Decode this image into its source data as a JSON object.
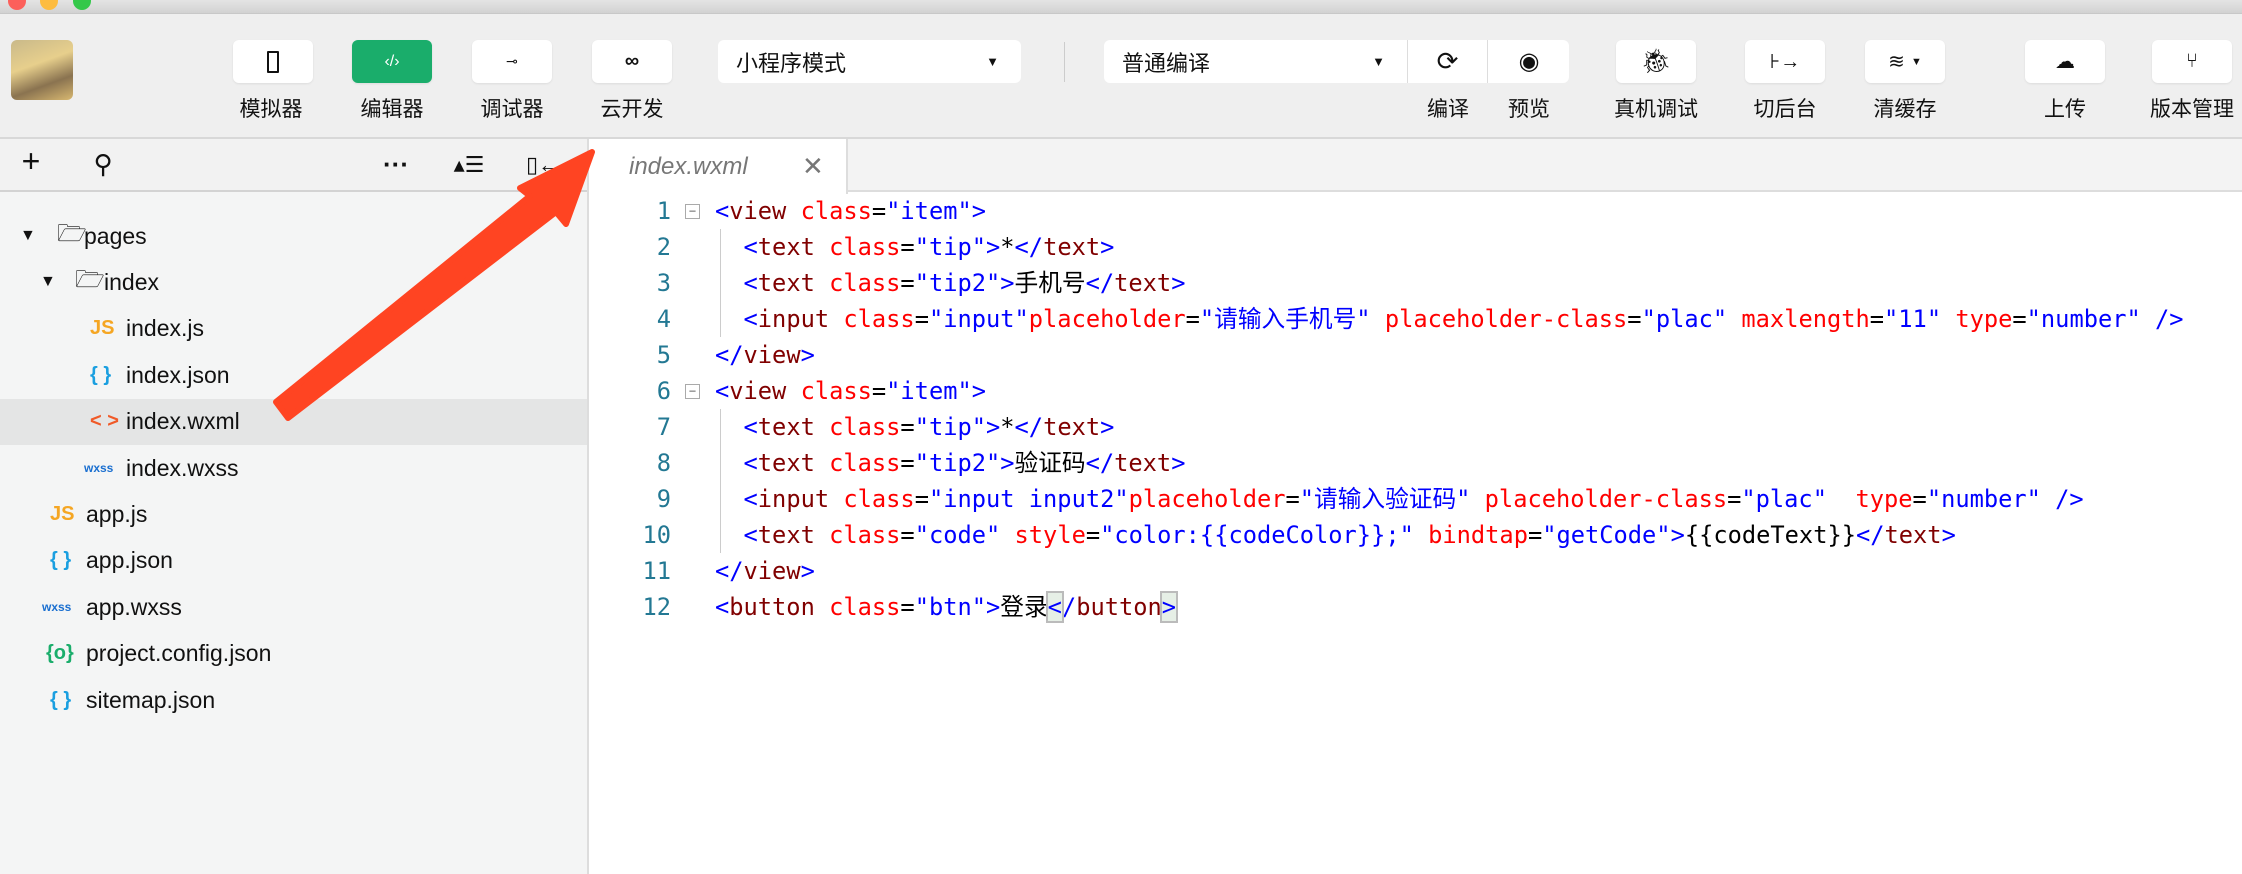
{
  "toolbar": {
    "buttons": [
      {
        "label": "模拟器",
        "icon": "phone-icon"
      },
      {
        "label": "编辑器",
        "icon": "code-icon"
      },
      {
        "label": "调试器",
        "icon": "debugger-icon"
      },
      {
        "label": "云开发",
        "icon": "cloud-dev-icon"
      }
    ],
    "mode_select": "小程序模式",
    "compile_select": "普通编译",
    "actions": [
      {
        "label": "编译",
        "icon": "refresh-icon"
      },
      {
        "label": "预览",
        "icon": "eye-icon"
      },
      {
        "label": "真机调试",
        "icon": "bug-icon"
      },
      {
        "label": "切后台",
        "icon": "switch-background-icon"
      },
      {
        "label": "清缓存",
        "icon": "layers-icon"
      },
      {
        "label": "上传",
        "icon": "cloud-upload-icon"
      },
      {
        "label": "版本管理",
        "icon": "branch-icon"
      }
    ],
    "accent": "#1aad6b"
  },
  "sidebar": {
    "tree": [
      {
        "name": "pages",
        "type": "folder"
      },
      {
        "name": "index",
        "type": "folder"
      },
      {
        "name": "index.js",
        "type": "js",
        "badge": "JS"
      },
      {
        "name": "index.json",
        "type": "json",
        "badge": "{ }"
      },
      {
        "name": "index.wxml",
        "type": "wxml",
        "badge": "< >",
        "selected": true
      },
      {
        "name": "index.wxss",
        "type": "wxss",
        "badge": "wxss"
      },
      {
        "name": "app.js",
        "type": "js",
        "badge": "JS"
      },
      {
        "name": "app.json",
        "type": "json",
        "badge": "{ }"
      },
      {
        "name": "app.wxss",
        "type": "wxss",
        "badge": "wxss"
      },
      {
        "name": "project.config.json",
        "type": "config",
        "badge": "{o}"
      },
      {
        "name": "sitemap.json",
        "type": "json",
        "badge": "{ }"
      }
    ]
  },
  "editor": {
    "tab": "index.wxml",
    "lines": [
      {
        "n": "1",
        "tokens": [
          {
            "k": "p",
            "v": "<"
          },
          {
            "k": "t",
            "v": "view"
          },
          {
            "k": "w",
            "v": " "
          },
          {
            "k": "a",
            "v": "class"
          },
          {
            "k": "e",
            "v": "="
          },
          {
            "k": "s",
            "v": "\"item\""
          },
          {
            "k": "p",
            "v": ">"
          }
        ]
      },
      {
        "n": "2",
        "tokens": [
          {
            "k": "w",
            "v": "  "
          },
          {
            "k": "p",
            "v": "<"
          },
          {
            "k": "t",
            "v": "text"
          },
          {
            "k": "w",
            "v": " "
          },
          {
            "k": "a",
            "v": "class"
          },
          {
            "k": "e",
            "v": "="
          },
          {
            "k": "s",
            "v": "\"tip\""
          },
          {
            "k": "p",
            "v": ">"
          },
          {
            "k": "x",
            "v": "*"
          },
          {
            "k": "p",
            "v": "</"
          },
          {
            "k": "t",
            "v": "text"
          },
          {
            "k": "p",
            "v": ">"
          }
        ]
      },
      {
        "n": "3",
        "tokens": [
          {
            "k": "w",
            "v": "  "
          },
          {
            "k": "p",
            "v": "<"
          },
          {
            "k": "t",
            "v": "text"
          },
          {
            "k": "w",
            "v": " "
          },
          {
            "k": "a",
            "v": "class"
          },
          {
            "k": "e",
            "v": "="
          },
          {
            "k": "s",
            "v": "\"tip2\""
          },
          {
            "k": "p",
            "v": ">"
          },
          {
            "k": "x",
            "v": "手机号"
          },
          {
            "k": "p",
            "v": "</"
          },
          {
            "k": "t",
            "v": "text"
          },
          {
            "k": "p",
            "v": ">"
          }
        ]
      },
      {
        "n": "4",
        "tokens": [
          {
            "k": "w",
            "v": "  "
          },
          {
            "k": "p",
            "v": "<"
          },
          {
            "k": "t",
            "v": "input"
          },
          {
            "k": "w",
            "v": " "
          },
          {
            "k": "a",
            "v": "class"
          },
          {
            "k": "e",
            "v": "="
          },
          {
            "k": "s",
            "v": "\"input\""
          },
          {
            "k": "a",
            "v": "placeholder"
          },
          {
            "k": "e",
            "v": "="
          },
          {
            "k": "s",
            "v": "\"请输入手机号\""
          },
          {
            "k": "w",
            "v": " "
          },
          {
            "k": "a",
            "v": "placeholder-class"
          },
          {
            "k": "e",
            "v": "="
          },
          {
            "k": "s",
            "v": "\"plac\""
          },
          {
            "k": "w",
            "v": " "
          },
          {
            "k": "a",
            "v": "maxlength"
          },
          {
            "k": "e",
            "v": "="
          },
          {
            "k": "s",
            "v": "\"11\""
          },
          {
            "k": "w",
            "v": " "
          },
          {
            "k": "a",
            "v": "type"
          },
          {
            "k": "e",
            "v": "="
          },
          {
            "k": "s",
            "v": "\"number\""
          },
          {
            "k": "w",
            "v": " "
          },
          {
            "k": "p",
            "v": "/>"
          }
        ]
      },
      {
        "n": "5",
        "tokens": [
          {
            "k": "p",
            "v": "</"
          },
          {
            "k": "t",
            "v": "view"
          },
          {
            "k": "p",
            "v": ">"
          }
        ]
      },
      {
        "n": "6",
        "tokens": [
          {
            "k": "p",
            "v": "<"
          },
          {
            "k": "t",
            "v": "view"
          },
          {
            "k": "w",
            "v": " "
          },
          {
            "k": "a",
            "v": "class"
          },
          {
            "k": "e",
            "v": "="
          },
          {
            "k": "s",
            "v": "\"item\""
          },
          {
            "k": "p",
            "v": ">"
          }
        ]
      },
      {
        "n": "7",
        "tokens": [
          {
            "k": "w",
            "v": "  "
          },
          {
            "k": "p",
            "v": "<"
          },
          {
            "k": "t",
            "v": "text"
          },
          {
            "k": "w",
            "v": " "
          },
          {
            "k": "a",
            "v": "class"
          },
          {
            "k": "e",
            "v": "="
          },
          {
            "k": "s",
            "v": "\"tip\""
          },
          {
            "k": "p",
            "v": ">"
          },
          {
            "k": "x",
            "v": "*"
          },
          {
            "k": "p",
            "v": "</"
          },
          {
            "k": "t",
            "v": "text"
          },
          {
            "k": "p",
            "v": ">"
          }
        ]
      },
      {
        "n": "8",
        "tokens": [
          {
            "k": "w",
            "v": "  "
          },
          {
            "k": "p",
            "v": "<"
          },
          {
            "k": "t",
            "v": "text"
          },
          {
            "k": "w",
            "v": " "
          },
          {
            "k": "a",
            "v": "class"
          },
          {
            "k": "e",
            "v": "="
          },
          {
            "k": "s",
            "v": "\"tip2\""
          },
          {
            "k": "p",
            "v": ">"
          },
          {
            "k": "x",
            "v": "验证码"
          },
          {
            "k": "p",
            "v": "</"
          },
          {
            "k": "t",
            "v": "text"
          },
          {
            "k": "p",
            "v": ">"
          }
        ]
      },
      {
        "n": "9",
        "tokens": [
          {
            "k": "w",
            "v": "  "
          },
          {
            "k": "p",
            "v": "<"
          },
          {
            "k": "t",
            "v": "input"
          },
          {
            "k": "w",
            "v": " "
          },
          {
            "k": "a",
            "v": "class"
          },
          {
            "k": "e",
            "v": "="
          },
          {
            "k": "s",
            "v": "\"input input2\""
          },
          {
            "k": "a",
            "v": "placeholder"
          },
          {
            "k": "e",
            "v": "="
          },
          {
            "k": "s",
            "v": "\"请输入验证码\""
          },
          {
            "k": "w",
            "v": " "
          },
          {
            "k": "a",
            "v": "placeholder-class"
          },
          {
            "k": "e",
            "v": "="
          },
          {
            "k": "s",
            "v": "\"plac\""
          },
          {
            "k": "w",
            "v": "  "
          },
          {
            "k": "a",
            "v": "type"
          },
          {
            "k": "e",
            "v": "="
          },
          {
            "k": "s",
            "v": "\"number\""
          },
          {
            "k": "w",
            "v": " "
          },
          {
            "k": "p",
            "v": "/>"
          }
        ]
      },
      {
        "n": "10",
        "tokens": [
          {
            "k": "w",
            "v": "  "
          },
          {
            "k": "p",
            "v": "<"
          },
          {
            "k": "t",
            "v": "text"
          },
          {
            "k": "w",
            "v": " "
          },
          {
            "k": "a",
            "v": "class"
          },
          {
            "k": "e",
            "v": "="
          },
          {
            "k": "s",
            "v": "\"code\""
          },
          {
            "k": "w",
            "v": " "
          },
          {
            "k": "a",
            "v": "style"
          },
          {
            "k": "e",
            "v": "="
          },
          {
            "k": "s",
            "v": "\"color:{{codeColor}};\""
          },
          {
            "k": "w",
            "v": " "
          },
          {
            "k": "a",
            "v": "bindtap"
          },
          {
            "k": "e",
            "v": "="
          },
          {
            "k": "s",
            "v": "\"getCode\""
          },
          {
            "k": "p",
            "v": ">"
          },
          {
            "k": "x",
            "v": "{{codeText}}"
          },
          {
            "k": "p",
            "v": "</"
          },
          {
            "k": "t",
            "v": "text"
          },
          {
            "k": "p",
            "v": ">"
          }
        ]
      },
      {
        "n": "11",
        "tokens": [
          {
            "k": "p",
            "v": "</"
          },
          {
            "k": "t",
            "v": "view"
          },
          {
            "k": "p",
            "v": ">"
          }
        ]
      },
      {
        "n": "12",
        "tokens": [
          {
            "k": "p",
            "v": "<"
          },
          {
            "k": "t",
            "v": "button"
          },
          {
            "k": "w",
            "v": " "
          },
          {
            "k": "a",
            "v": "class"
          },
          {
            "k": "e",
            "v": "="
          },
          {
            "k": "s",
            "v": "\"btn\""
          },
          {
            "k": "p",
            "v": ">"
          },
          {
            "k": "x",
            "v": "登录"
          },
          {
            "k": "bm",
            "v": "<"
          },
          {
            "k": "p",
            "v": "/"
          },
          {
            "k": "t",
            "v": "button"
          },
          {
            "k": "bm",
            "v": ">"
          }
        ]
      }
    ]
  },
  "annotation_color": "#ff4422"
}
